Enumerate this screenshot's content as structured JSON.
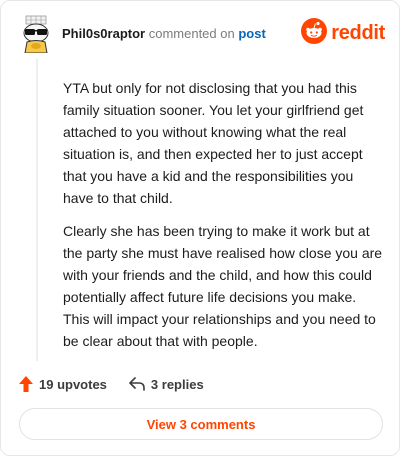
{
  "header": {
    "username": "Phil0s0raptor",
    "action_text": "commented on",
    "post_link": "post",
    "brand": "reddit"
  },
  "comment": {
    "paragraphs": [
      "YTA but only for not disclosing that you had this family situation sooner. You let your girlfriend get attached to you without knowing what the real situation is, and then expected her to just accept that you have a kid and the responsibilities you have to that child.",
      "Clearly she has been trying to make it work but at the party she must have realised how close you are with your friends and the child, and how this could potentially affect future life decisions you make. This will impact your relationships and you need to be clear about that with people."
    ]
  },
  "actions": {
    "upvotes": "19 upvotes",
    "replies": "3 replies"
  },
  "footer": {
    "view_comments": "View 3 comments"
  },
  "colors": {
    "brand": "#ff4500",
    "link": "#0a66b7",
    "muted": "#7c7c7c"
  }
}
